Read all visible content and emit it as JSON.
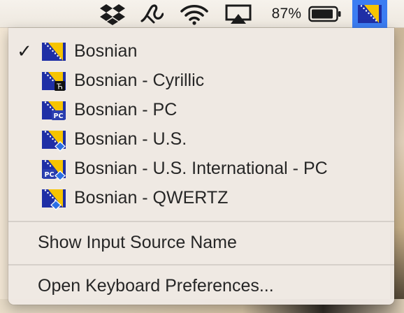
{
  "menubar": {
    "battery_percent": "87%",
    "icons": [
      "dropbox-icon",
      "script-app-icon",
      "wifi-icon",
      "airplay-icon",
      "battery-icon",
      "bosnia-flag-icon"
    ]
  },
  "menu": {
    "input_sources": [
      {
        "label": "Bosnian",
        "checked": "✓",
        "badge": "none"
      },
      {
        "label": "Bosnian - Cyrillic",
        "checked": "",
        "badge": "cyrillic"
      },
      {
        "label": "Bosnian - PC",
        "checked": "",
        "badge": "pc"
      },
      {
        "label": "Bosnian - U.S.",
        "checked": "",
        "badge": "diamond"
      },
      {
        "label": "Bosnian - U.S. International - PC",
        "checked": "",
        "badge": "pc-diamond"
      },
      {
        "label": "Bosnian - QWERTZ",
        "checked": "",
        "badge": "diamond"
      }
    ],
    "show_input_source_name": "Show Input Source Name",
    "open_keyboard_preferences": "Open Keyboard Preferences..."
  },
  "badges": {
    "cyrillic_glyph": "Ћ",
    "pc_text": "PC"
  },
  "colors": {
    "flag_blue": "#1f2fa6",
    "flag_yellow": "#f6c400",
    "active_highlight": "#3c7df2",
    "badge_blue": "#2b6fe6"
  }
}
